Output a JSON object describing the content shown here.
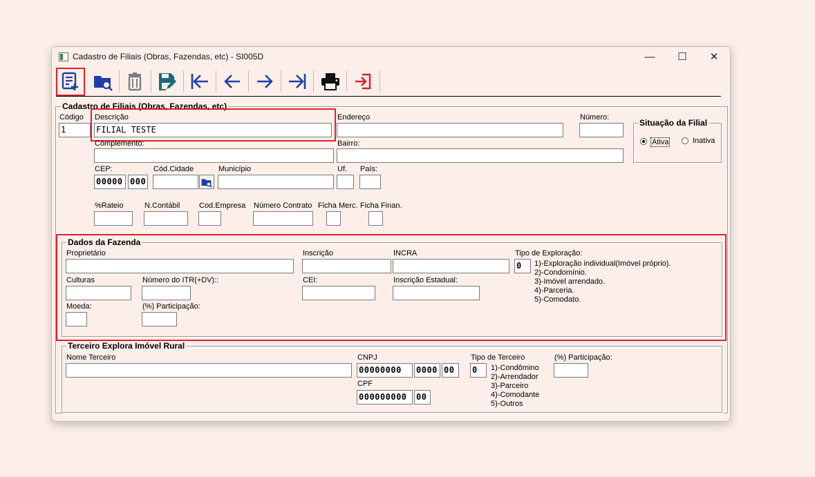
{
  "window": {
    "title": "Cadastro de Filiais (Obras, Fazendas, etc) - SI005D",
    "minimize": "—",
    "maximize": "☐",
    "close": "✕"
  },
  "toolbar": {
    "icons": [
      "new-record-icon",
      "search-folder-icon",
      "trash-icon",
      "save-edit-icon",
      "first-record-icon",
      "previous-record-icon",
      "next-record-icon",
      "last-record-icon",
      "printer-icon",
      "exit-icon"
    ]
  },
  "filial": {
    "legend": "Cadastro de Filiais (Obras, Fazendas, etc)",
    "codigo_label": "Código",
    "codigo_value": "1",
    "descricao_label": "Descrição",
    "descricao_value": "FILIAL TESTE",
    "endereco_label": "Endereço",
    "endereco_value": "",
    "numero_label": "Número:",
    "numero_value": "",
    "complemento_label": "Complemento:",
    "bairro_label": "Bairro:",
    "cep_label": "CEP:",
    "cep_part1": "00000",
    "cep_part2": "000",
    "cod_cidade_label": "Cód.Cidade",
    "municipio_label": "Município",
    "uf_label": "Uf.",
    "pais_label": "País:",
    "rateio_label": "%Rateio",
    "ncontabil_label": "N.Contábil",
    "codempresa_label": "Cod.Empresa",
    "numcontrato_label": "Número Contrato",
    "fichamerc_label": "Ficha Merc.",
    "fichafinan_label": "Ficha Finan."
  },
  "situacao": {
    "legend": "Situação da Filial",
    "ativa": "Ativa",
    "inativa": "Inativa",
    "selected": "Ativa"
  },
  "fazenda": {
    "legend": "Dados da Fazenda",
    "proprietario_label": "Proprietário",
    "inscricao_label": "Inscrição",
    "incra_label": "INCRA",
    "tipo_exploracao_label": "Tipo de Exploração:",
    "tipo_exploracao_value": "0",
    "tipo_options": [
      "1)-Exploração individual(Imóvel próprio).",
      "2)-Condomínio.",
      "3)-Imóvel arrendado.",
      "4)-Parceria.",
      "5)-Comodato."
    ],
    "culturas_label": "Culturas",
    "itr_label": "Número do ITR(+DV)::",
    "cei_label": "CEI:",
    "inscricao_estadual_label": "Inscrição Estadual:",
    "moeda_label": "Moeda:",
    "participacao_label": "(%) Participação:"
  },
  "terceiro": {
    "legend": "Terceiro Explora Imóvel Rural",
    "nome_label": "Nome Terceiro",
    "cnpj_label": "CNPJ",
    "cnpj_part1": "00000000",
    "cnpj_part2": "0000",
    "cnpj_part3": "00",
    "cpf_label": "CPF",
    "cpf_part1": "000000000",
    "cpf_part2": "00",
    "tipo_label": "Tipo de Terceiro",
    "tipo_value": "0",
    "tipo_options": [
      "1)-Condômino",
      "2)-Arrendador",
      "3)-Parceiro",
      "4)-Comodante",
      "5)-Outros"
    ],
    "participacao_label": "(%) Participação:"
  }
}
